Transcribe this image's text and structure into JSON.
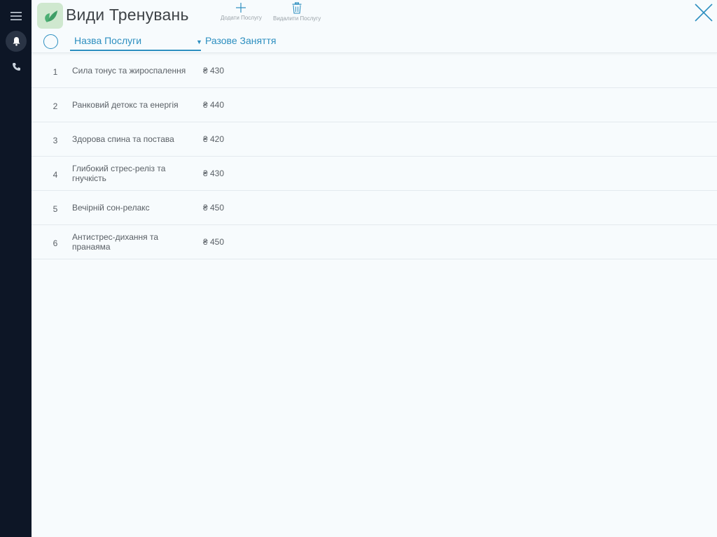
{
  "sidebar": {
    "icons": [
      "hamburger-menu-icon",
      "bell-icon",
      "phone-icon"
    ]
  },
  "header": {
    "title": "Види Тренувань",
    "add_label": "Додати Послугу",
    "delete_label": "Видалити Послугу"
  },
  "columns": {
    "name": "Назва Послуги",
    "price": "Разове Заняття"
  },
  "services": [
    {
      "num": "1",
      "name": "Сила   тонус та жироспалення",
      "price": "₴ 430"
    },
    {
      "num": "2",
      "name": "Ранковий детокс та енергія",
      "price": "₴ 440"
    },
    {
      "num": "3",
      "name": "Здорова спина та постава",
      "price": "₴ 420"
    },
    {
      "num": "4",
      "name": "Глибокий стрес-реліз та гнучкість",
      "price": "₴ 430"
    },
    {
      "num": "5",
      "name": "Вечірній сон-релакс",
      "price": "₴ 450"
    },
    {
      "num": "6",
      "name": "Антистрес-дихання та пранаяма",
      "price": "₴ 450"
    }
  ],
  "colors": {
    "accent": "#2d8fc0",
    "sidebar_bg": "#0d1626",
    "logo_bg": "#cfe8cf",
    "leaf": "#4caf73"
  }
}
